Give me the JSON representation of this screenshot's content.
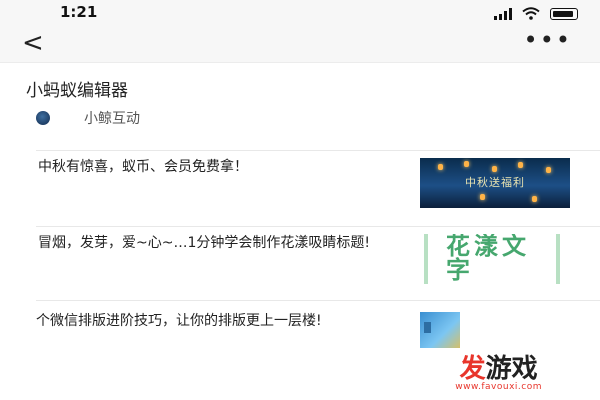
{
  "status_bar": {
    "time": "1:21"
  },
  "nav": {
    "back_glyph": "<",
    "more_glyph": "•••"
  },
  "page": {
    "title": "小蚂蚁编辑器"
  },
  "author": {
    "name": "小鲸互动"
  },
  "articles": [
    {
      "title": "中秋有惊喜，蚁币、会员免费拿！",
      "thumb_text": "中秋送福利"
    },
    {
      "title": "冒烟，发芽，爱~心~…1分钟学会制作花漾吸睛标题!",
      "thumb_text": "花漾文字"
    },
    {
      "title": "个微信排版进阶技巧，让你的排版更上一层楼!"
    }
  ],
  "watermark": {
    "text_red": "发",
    "text_dark": "游戏",
    "url": "www.favouxi.com"
  },
  "colors": {
    "accent_red": "#e8352b",
    "thumb_green": "#46a76e",
    "thumb_navy": "#0a2c4d"
  }
}
